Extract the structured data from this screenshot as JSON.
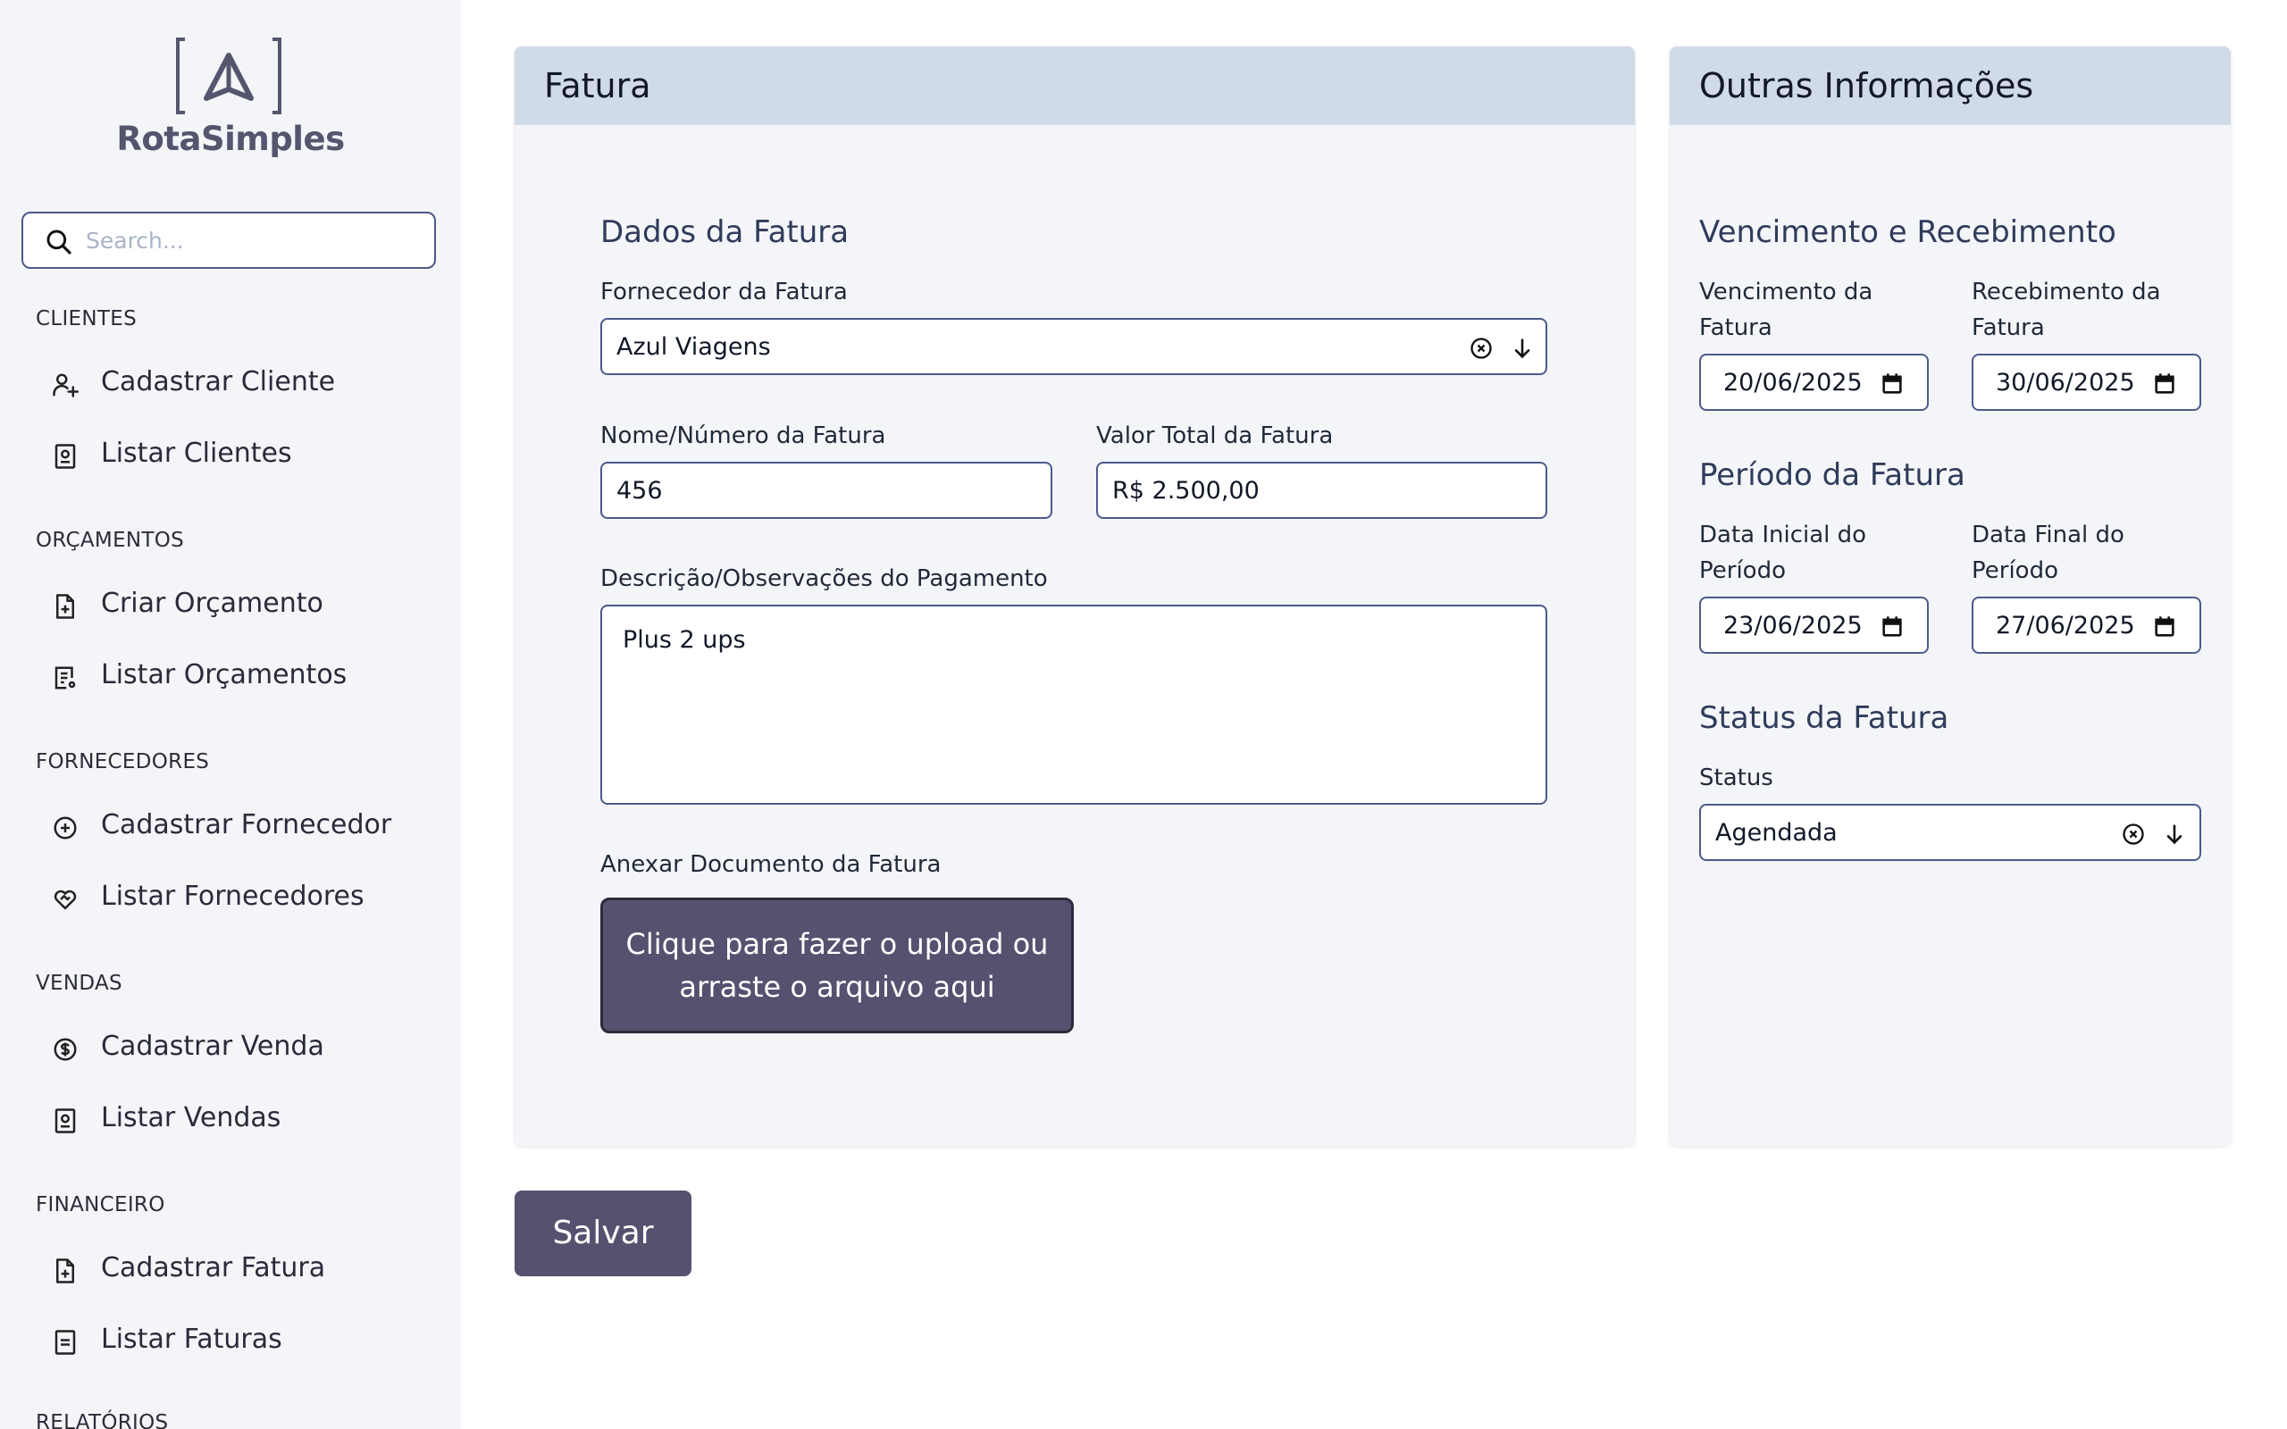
{
  "app": {
    "brand": "RotaSimples"
  },
  "search": {
    "placeholder": "Search..."
  },
  "sidebar": {
    "sections": [
      {
        "title": "CLIENTES",
        "items": [
          {
            "label": "Cadastrar Cliente",
            "icon": "user-plus-icon"
          },
          {
            "label": "Listar Clientes",
            "icon": "contact-list-icon"
          }
        ]
      },
      {
        "title": "ORÇAMENTOS",
        "items": [
          {
            "label": "Criar Orçamento",
            "icon": "file-plus-icon"
          },
          {
            "label": "Listar Orçamentos",
            "icon": "file-list-icon"
          }
        ]
      },
      {
        "title": "FORNECEDORES",
        "items": [
          {
            "label": "Cadastrar Fornecedor",
            "icon": "plus-circle-icon"
          },
          {
            "label": "Listar Fornecedores",
            "icon": "heart-handshake-icon"
          }
        ]
      },
      {
        "title": "VENDAS",
        "items": [
          {
            "label": "Cadastrar Venda",
            "icon": "dollar-circle-icon"
          },
          {
            "label": "Listar Vendas",
            "icon": "contact-list-icon"
          }
        ]
      },
      {
        "title": "FINANCEIRO",
        "items": [
          {
            "label": "Cadastrar Fatura",
            "icon": "file-plus-icon"
          },
          {
            "label": "Listar Faturas",
            "icon": "file-text-icon"
          }
        ]
      },
      {
        "title": "RELATÓRIOS"
      }
    ]
  },
  "fatura": {
    "title": "Fatura",
    "section_title": "Dados da Fatura",
    "fornecedor": {
      "label": "Fornecedor da Fatura",
      "value": "Azul Viagens"
    },
    "nome_numero": {
      "label": "Nome/Número da Fatura",
      "value": "456"
    },
    "valor_total": {
      "label": "Valor Total da Fatura",
      "value": "R$ 2.500,00"
    },
    "descricao": {
      "label": "Descrição/Observações do Pagamento",
      "value": "Plus 2 ups"
    },
    "anexo": {
      "label": "Anexar Documento da Fatura",
      "upload_line1": "Clique para fazer o upload ou",
      "upload_line2": "arraste o arquivo aqui"
    }
  },
  "outras": {
    "title": "Outras Informações",
    "vencimento_section": "Vencimento e Recebimento",
    "vencimento": {
      "label1": "Vencimento da",
      "label2": "Fatura",
      "value": "20/06/2025"
    },
    "recebimento": {
      "label1": "Recebimento da",
      "label2": "Fatura",
      "value": "30/06/2025"
    },
    "periodo_section": "Período da Fatura",
    "data_inicial": {
      "label1": "Data Inicial do",
      "label2": "Período",
      "value": "23/06/2025"
    },
    "data_final": {
      "label1": "Data Final do",
      "label2": "Período",
      "value": "27/06/2025"
    },
    "status_section": "Status da Fatura",
    "status": {
      "label": "Status",
      "value": "Agendada"
    }
  },
  "actions": {
    "save_label": "Salvar"
  },
  "colors": {
    "accent": "#55516f",
    "panel_header": "#d1dae7",
    "sidebar_bg": "#f4f5f8",
    "border": "#4a5a8c"
  }
}
